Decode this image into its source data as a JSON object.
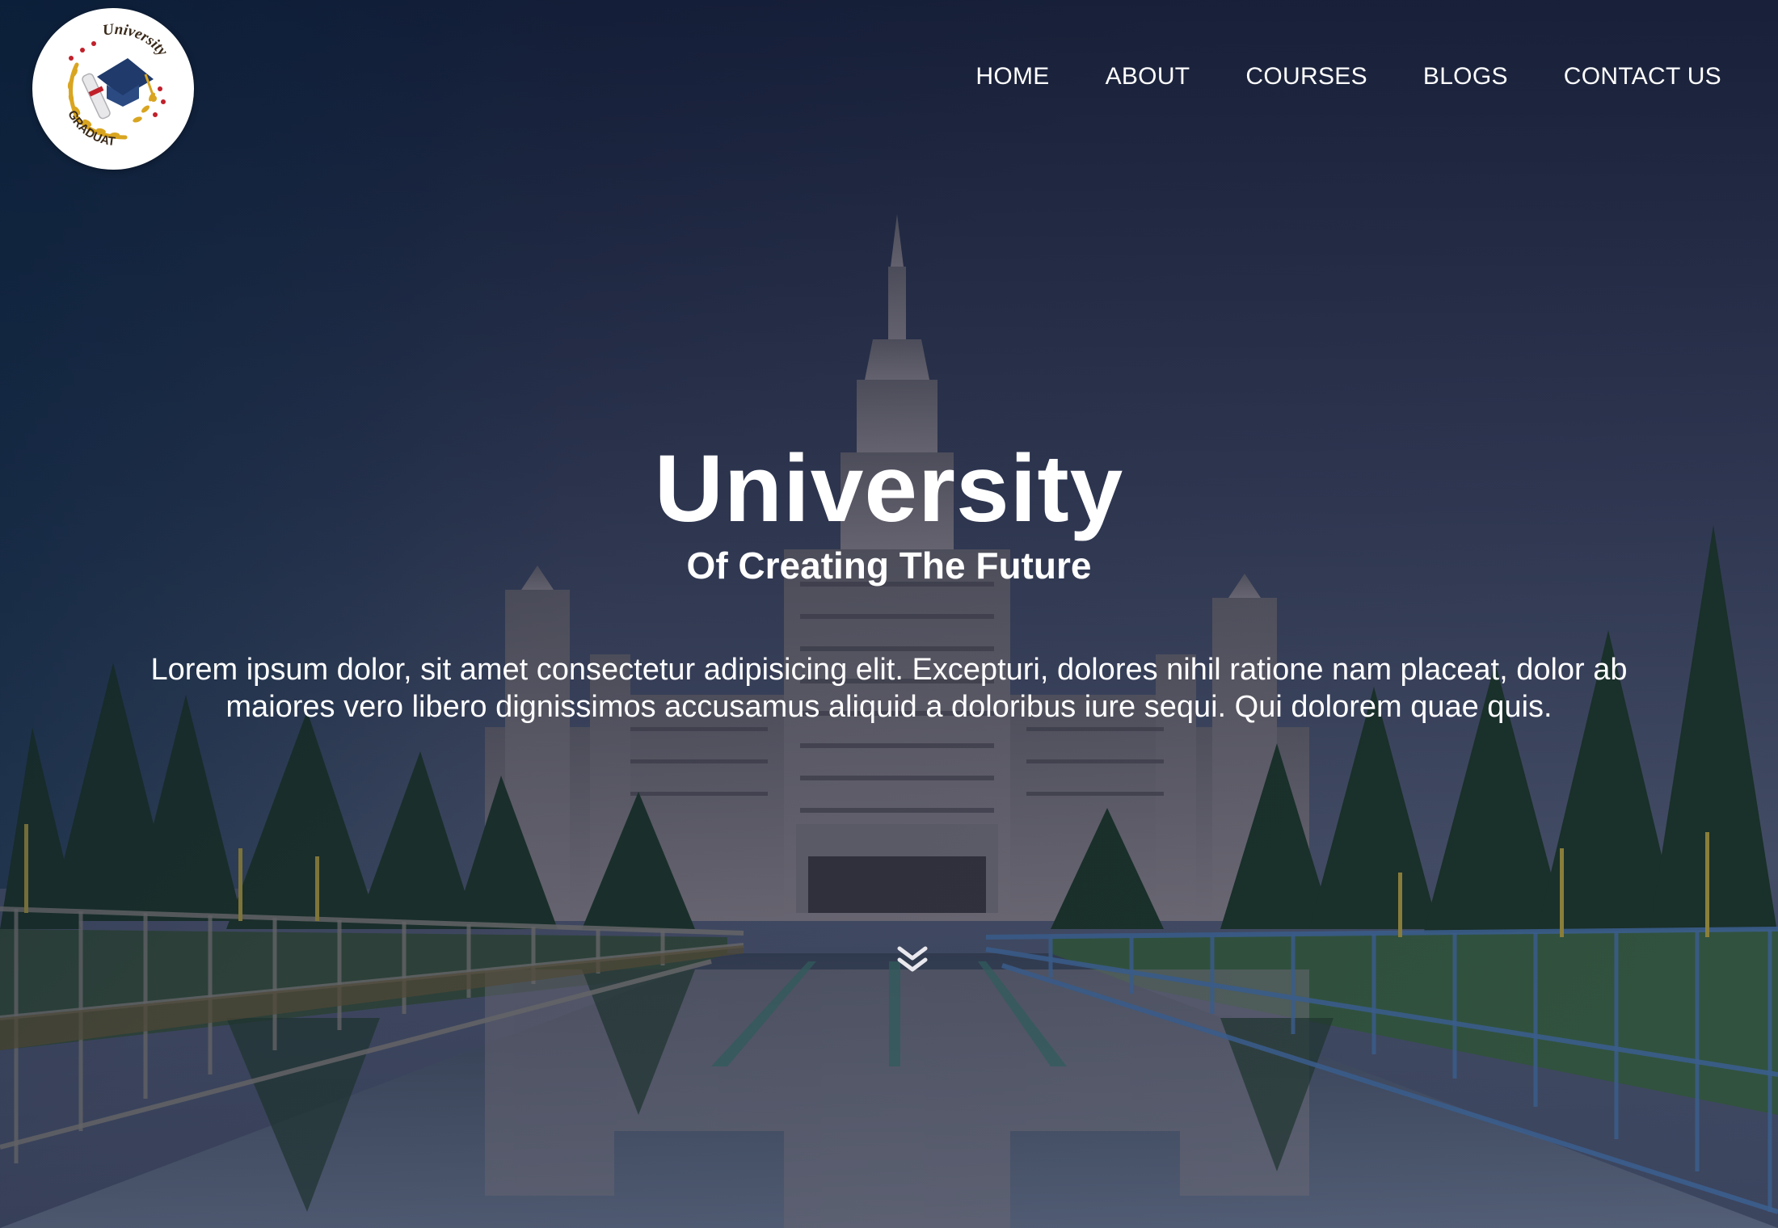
{
  "logo": {
    "top_text": "University",
    "bottom_text": "GRADUATE",
    "icon": "graduation-cap-icon"
  },
  "nav": {
    "items": [
      {
        "label": "HOME"
      },
      {
        "label": "ABOUT"
      },
      {
        "label": "COURSES"
      },
      {
        "label": "BLOGS"
      },
      {
        "label": "CONTACT US"
      }
    ]
  },
  "hero": {
    "title": "University",
    "subtitle": "Of Creating The Future",
    "description": "Lorem ipsum dolor, sit amet consectetur adipisicing elit. Excepturi, dolores nihil ratione nam placeat, dolor ab maiores vero libero dignissimos accusamus aliquid a doloribus iure sequi. Qui dolorem quae quis.",
    "scroll_icon": "double-chevron-down-icon"
  },
  "colors": {
    "overlay": "#0e1a35",
    "text": "#ffffff",
    "logo_accent": "#d9a520",
    "logo_cap": "#1f3a6b",
    "logo_star": "#c0202a"
  }
}
